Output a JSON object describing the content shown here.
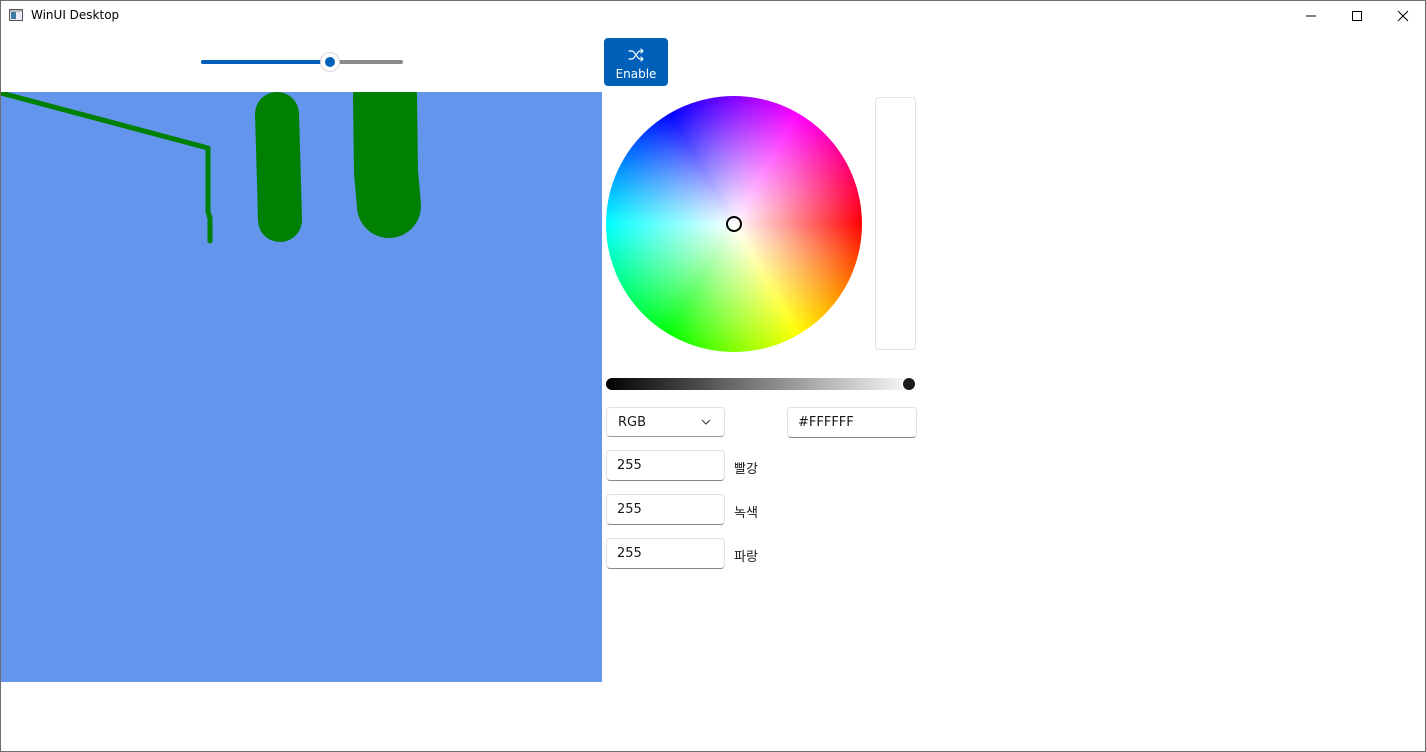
{
  "window": {
    "title": "WinUI Desktop",
    "minimize_icon": "minimize-icon",
    "maximize_icon": "maximize-icon",
    "close_icon": "close-icon"
  },
  "toolbar": {
    "stroke_size_level": 0.64,
    "enable_button": {
      "label": "Enable",
      "icon": "shuffle-icon"
    }
  },
  "canvas": {
    "background": "#6495ED",
    "ink_color": "#008000"
  },
  "color_picker": {
    "mode": "RGB",
    "hex_value": "#FFFFFF",
    "value_level": 1.0,
    "preview_color": "#FFFFFF",
    "channels": [
      {
        "value": "255",
        "label": "빨강"
      },
      {
        "value": "255",
        "label": "녹색"
      },
      {
        "value": "255",
        "label": "파랑"
      }
    ]
  }
}
